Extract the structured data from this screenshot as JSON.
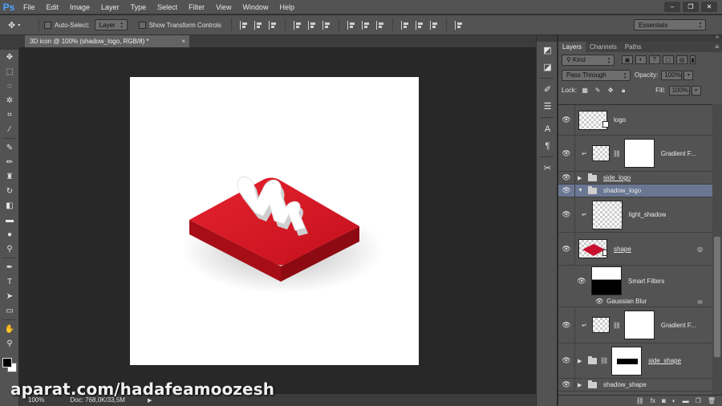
{
  "menubar": {
    "logo": "Ps",
    "items": [
      "File",
      "Edit",
      "Image",
      "Layer",
      "Type",
      "Select",
      "Filter",
      "View",
      "Window",
      "Help"
    ],
    "window_controls": [
      "‒",
      "❐",
      "✕"
    ]
  },
  "options": {
    "auto_select_label": "Auto-Select:",
    "auto_select_value": "Layer",
    "transform_label": "Show Transform Controls",
    "workspace": "Essentials"
  },
  "document": {
    "tab_title": "3D icon @ 100% (shadow_logo, RGB/8) *",
    "tab_close": "×",
    "zoom": "100%",
    "doc_info": "Doc: 768,0K/33,5M",
    "status_arrow": "▶"
  },
  "watermark": "aparat.com/hadafeamoozesh",
  "colors": {
    "logo_red": "#c8102e",
    "selection_blue": "#6a7793",
    "ps_blue": "#4fa3ff"
  },
  "layers_panel": {
    "tabs": [
      "Layers",
      "Channels",
      "Paths"
    ],
    "filter_value": "Kind",
    "blend_mode": "Pass Through",
    "opacity_label": "Opacity:",
    "opacity_value": "100%",
    "lock_label": "Lock:",
    "fill_label": "Fill:",
    "fill_value": "100%",
    "layers": {
      "logo": "logo",
      "gradient1": "Gradient F...",
      "side_logo": "side_logo",
      "shadow_logo": "shadow_logo",
      "light_shadow": "light_shadow",
      "shape": "shape",
      "smart_filters": "Smart Filters",
      "gaussian_blur": "Gaussian Blur",
      "gradient2": "Gradient F...",
      "side_shape": "side_shape",
      "shadow_shape": "shadow_shape"
    },
    "footer_icons": [
      "link-icon",
      "fx-icon",
      "mask-icon",
      "adjustment-icon",
      "group-icon",
      "new-layer-icon",
      "trash-icon"
    ]
  },
  "tools": [
    "move-icon",
    "marquee-icon",
    "lasso-icon",
    "magic-wand-icon",
    "crop-icon",
    "eyedropper-icon",
    "healing-brush-icon",
    "brush-icon",
    "clone-stamp-icon",
    "history-brush-icon",
    "eraser-icon",
    "gradient-icon",
    "blur-icon",
    "dodge-icon",
    "pen-icon",
    "type-icon",
    "path-select-icon",
    "shape-icon",
    "hand-icon",
    "zoom-icon"
  ]
}
